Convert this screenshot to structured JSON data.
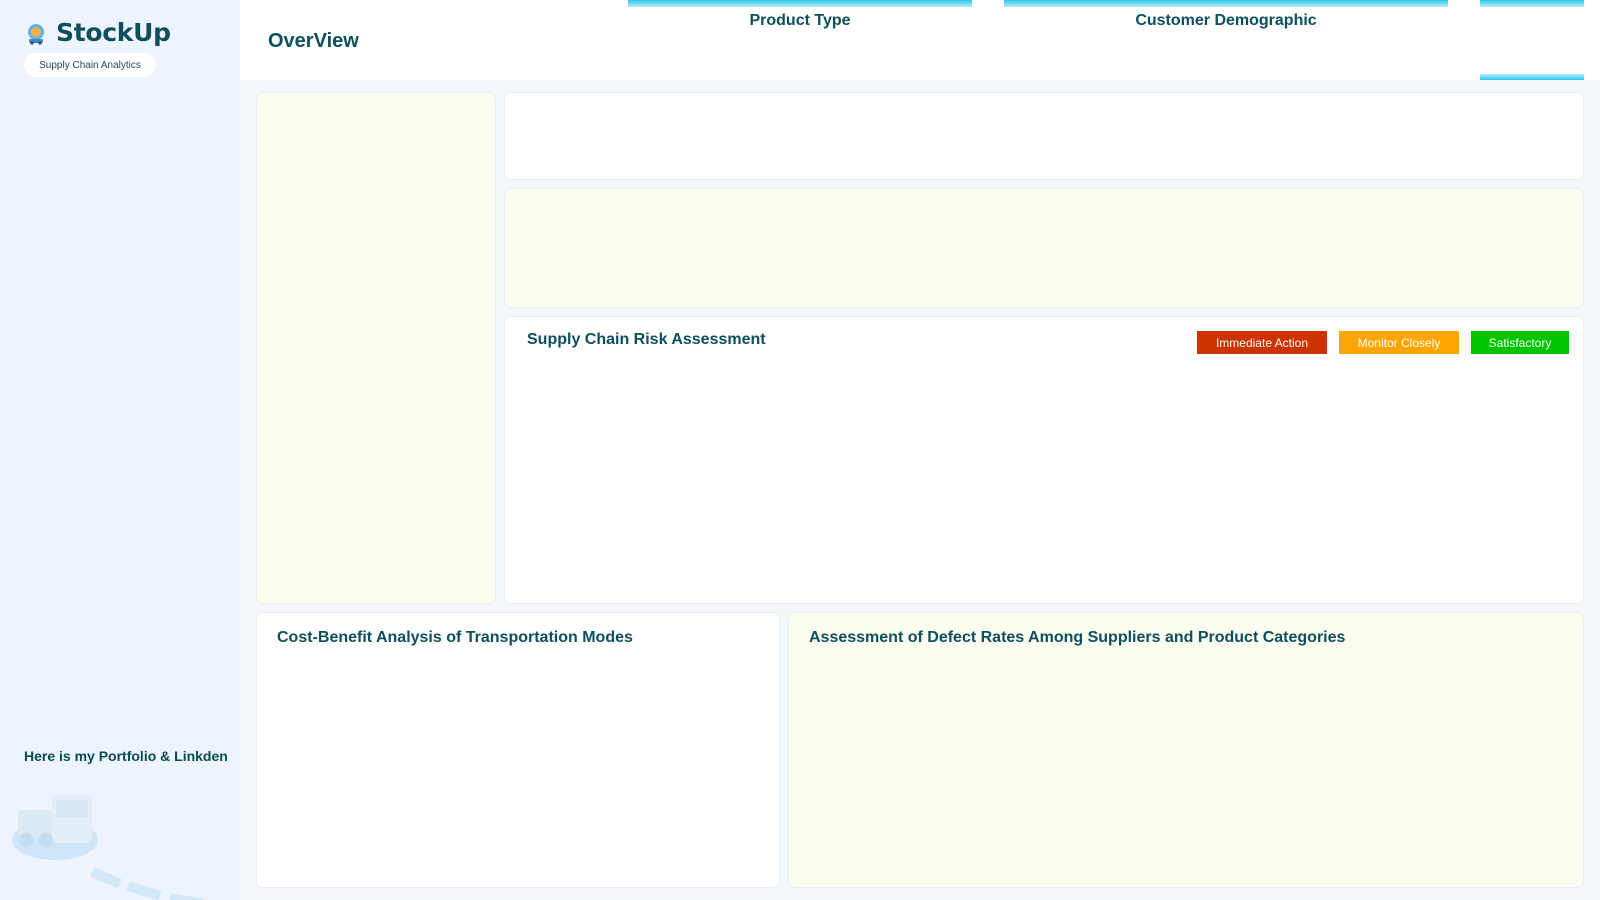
{
  "sidebar": {
    "brand_name": "StockUp",
    "brand_subtitle": "Supply Chain Analytics",
    "portfolio_link": "Here is my Portfolio & Linkden"
  },
  "header": {
    "title": "OverView",
    "filters": [
      {
        "label": "Product Type"
      },
      {
        "label": "Customer Demographic"
      }
    ]
  },
  "cards": {
    "risk": {
      "title": "Supply Chain Risk Assessment",
      "legend": [
        {
          "label": "Immediate Action",
          "color": "#cc3300"
        },
        {
          "label": "Monitor Closely",
          "color": "#ffa500"
        },
        {
          "label": "Satisfactory",
          "color": "#00c400"
        }
      ]
    },
    "cost_benefit": {
      "title": "Cost-Benefit Analysis of Transportation Modes"
    },
    "defect": {
      "title": "Assessment of Defect Rates Among Suppliers and Product Categories"
    }
  },
  "colors": {
    "accent": "#29c6ea",
    "title_text": "#0d4f5c",
    "cream_panel": "#fafdf0",
    "sidebar_bg": "#eef4fd"
  }
}
